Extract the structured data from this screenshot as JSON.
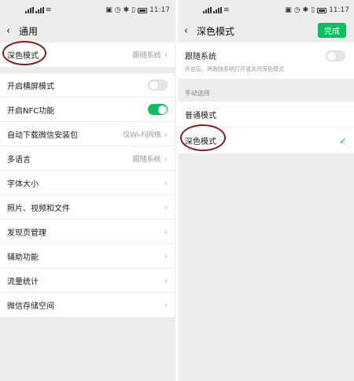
{
  "left": {
    "status": {
      "time": "11:17"
    },
    "nav": {
      "title": "通用"
    },
    "dark_mode_row": {
      "label": "深色模式",
      "value": "跟随系统"
    },
    "rows": [
      {
        "label": "开启横屏模式",
        "type": "toggle",
        "state": "off"
      },
      {
        "label": "开启NFC功能",
        "type": "toggle",
        "state": "on"
      },
      {
        "label": "自动下载微信安装包",
        "type": "value",
        "value": "仅Wi-Fi网络"
      },
      {
        "label": "多语言",
        "type": "value",
        "value": "跟随系统"
      },
      {
        "label": "字体大小",
        "type": "link"
      },
      {
        "label": "照片、视频和文件",
        "type": "link"
      },
      {
        "label": "发现页管理",
        "type": "link"
      },
      {
        "label": "辅助功能",
        "type": "link"
      },
      {
        "label": "流量统计",
        "type": "link"
      },
      {
        "label": "微信存储空间",
        "type": "link"
      }
    ]
  },
  "right": {
    "status": {
      "time": "11:17"
    },
    "nav": {
      "title": "深色模式",
      "done_label": "完成"
    },
    "follow": {
      "title": "跟随系统",
      "desc": "开启后，将跟随系统打开或关闭深色模式",
      "state": "off"
    },
    "manual_header": "手动选择",
    "options": [
      {
        "label": "普通模式",
        "selected": false
      },
      {
        "label": "深色模式",
        "selected": true
      }
    ]
  },
  "colors": {
    "accent": "#07c160",
    "annotation": "#8b1a1a"
  }
}
